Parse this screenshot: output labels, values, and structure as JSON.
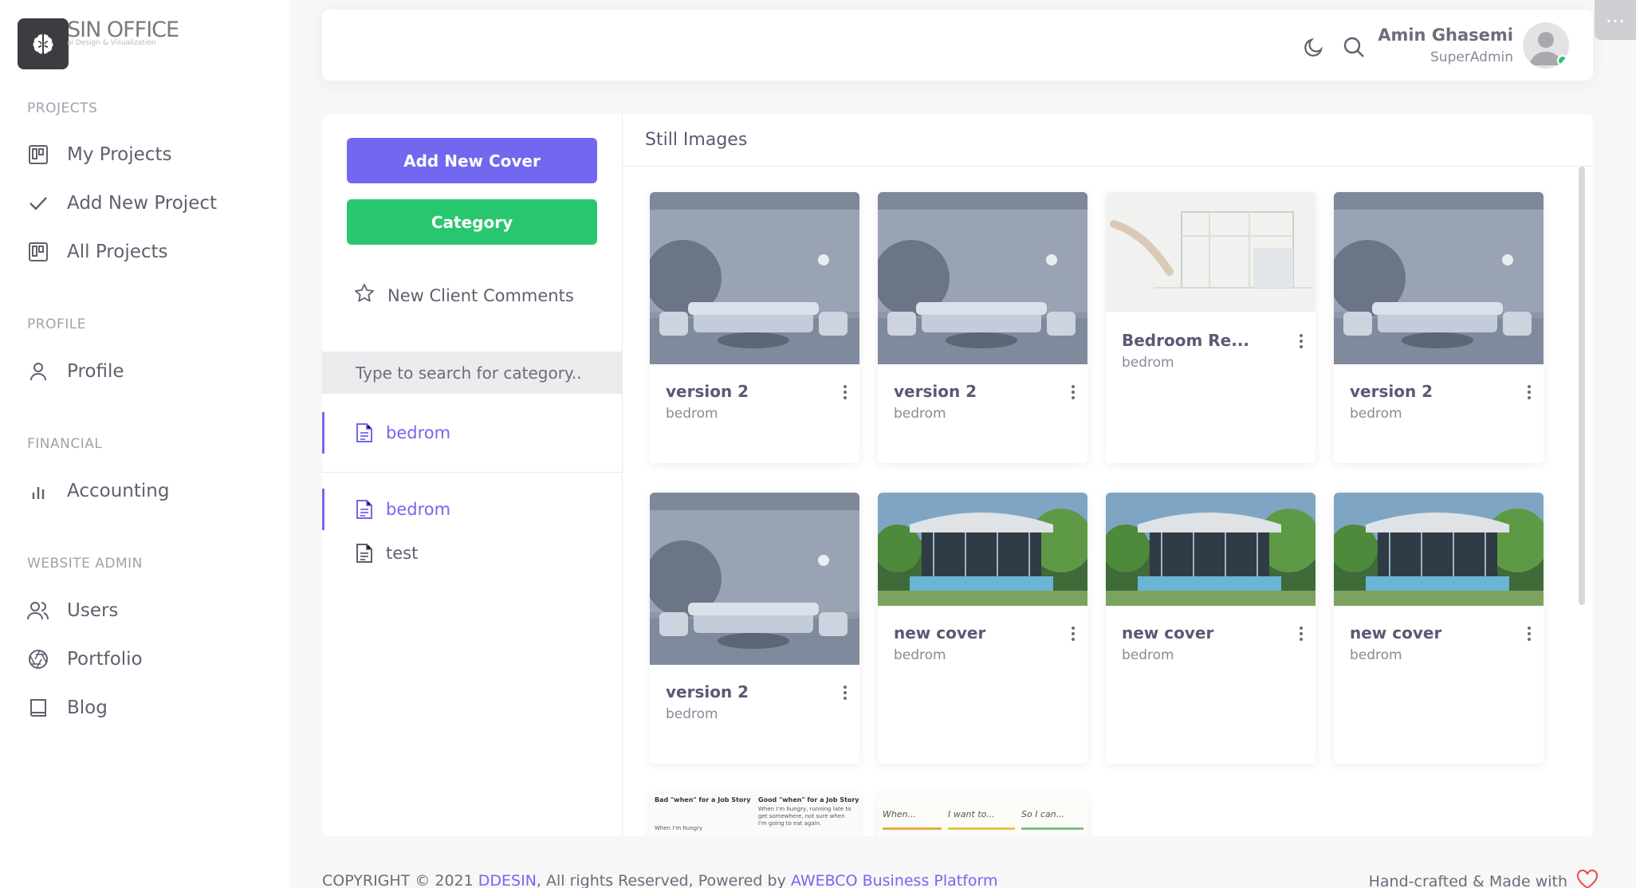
{
  "brand": {
    "name": "SIN OFFICE",
    "tagline": "al Design & Visualization"
  },
  "sidebar": {
    "sections": [
      {
        "title": "PROJECTS",
        "items": [
          {
            "label": "My Projects",
            "icon": "board-icon"
          },
          {
            "label": "Add New Project",
            "icon": "check-icon"
          },
          {
            "label": "All Projects",
            "icon": "board-icon"
          }
        ]
      },
      {
        "title": "PROFILE",
        "items": [
          {
            "label": "Profile",
            "icon": "user-icon"
          }
        ]
      },
      {
        "title": "FINANCIAL",
        "items": [
          {
            "label": "Accounting",
            "icon": "bar-chart-icon"
          }
        ]
      },
      {
        "title": "WEBSITE ADMIN",
        "items": [
          {
            "label": "Users",
            "icon": "users-icon"
          },
          {
            "label": "Portfolio",
            "icon": "aperture-icon"
          },
          {
            "label": "Blog",
            "icon": "book-icon"
          }
        ]
      }
    ]
  },
  "header": {
    "user_name": "Amin Ghasemi",
    "user_role": "SuperAdmin",
    "corner_label": "..."
  },
  "left_panel": {
    "add_cover_label": "Add New Cover",
    "category_label": "Category",
    "comments_label": "New Client Comments",
    "search_placeholder": "Type to search for category..",
    "categories_top": [
      {
        "label": "bedrom"
      }
    ],
    "categories": [
      {
        "label": "bedrom"
      },
      {
        "label": "test"
      }
    ]
  },
  "gallery": {
    "title": "Still Images",
    "cards": [
      {
        "title": "version 2",
        "category": "bedrom",
        "image": "living-room"
      },
      {
        "title": "version 2",
        "category": "bedrom",
        "image": "living-room"
      },
      {
        "title": "Bedroom Re...",
        "category": "bedrom",
        "image": "sketch"
      },
      {
        "title": "version 2",
        "category": "bedrom",
        "image": "living-room"
      },
      {
        "title": "version 2",
        "category": "bedrom",
        "image": "living-room"
      },
      {
        "title": "new cover",
        "category": "bedrom",
        "image": "villa"
      },
      {
        "title": "new cover",
        "category": "bedrom",
        "image": "villa"
      },
      {
        "title": "new cover",
        "category": "bedrom",
        "image": "villa"
      }
    ],
    "partial_cards": [
      {
        "heading_a": "Bad \"when\" for a Job Story",
        "heading_b": "Good \"when\" for a Job Story",
        "note_a": "When I'm hungry",
        "note_b": "When I'm hungry, running late to get somewhere, not sure when I'm going to eat again."
      },
      {
        "words": [
          "When...",
          "I want to...",
          "So I can..."
        ]
      }
    ]
  },
  "footer": {
    "copyright": "COPYRIGHT © 2021 ",
    "brand_link": "DDESIN",
    "rights": ", All rights Reserved, Powered by ",
    "platform_link": "AWEBCO Business Platform",
    "made_with": "Hand-crafted & Made with"
  },
  "colors": {
    "primary": "#7367f0",
    "success": "#28c76f",
    "text": "#5e5873"
  }
}
